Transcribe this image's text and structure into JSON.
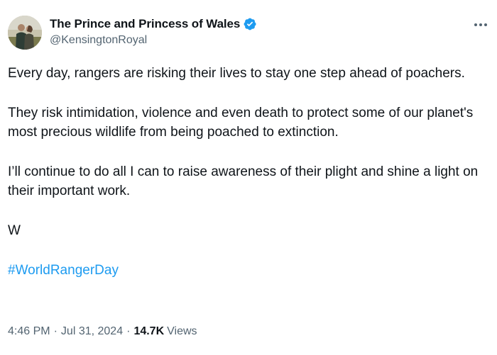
{
  "tweet": {
    "author": {
      "display_name": "The Prince and Princess of Wales",
      "handle": "@KensingtonRoyal",
      "verified": true,
      "verified_color": "#1d9bf0"
    },
    "paragraphs": [
      "Every day, rangers are risking their lives to stay one step ahead of poachers.",
      "They risk intimidation, violence and even death to protect some of our planet's most precious wildlife from being poached to extinction.",
      "I’ll continue to do all I can to raise awareness of their plight and shine a light on their important work.",
      "W"
    ],
    "hashtag": "#WorldRangerDay",
    "time": "4:46 PM",
    "date": "Jul 31, 2024",
    "separator": "·",
    "views_count": "14.7K",
    "views_label": "Views",
    "icons": {
      "verified": "verified-badge-icon",
      "more": "more-options-icon"
    },
    "colors": {
      "text": "#0f1419",
      "secondary": "#536471",
      "link": "#1d9bf0"
    }
  }
}
